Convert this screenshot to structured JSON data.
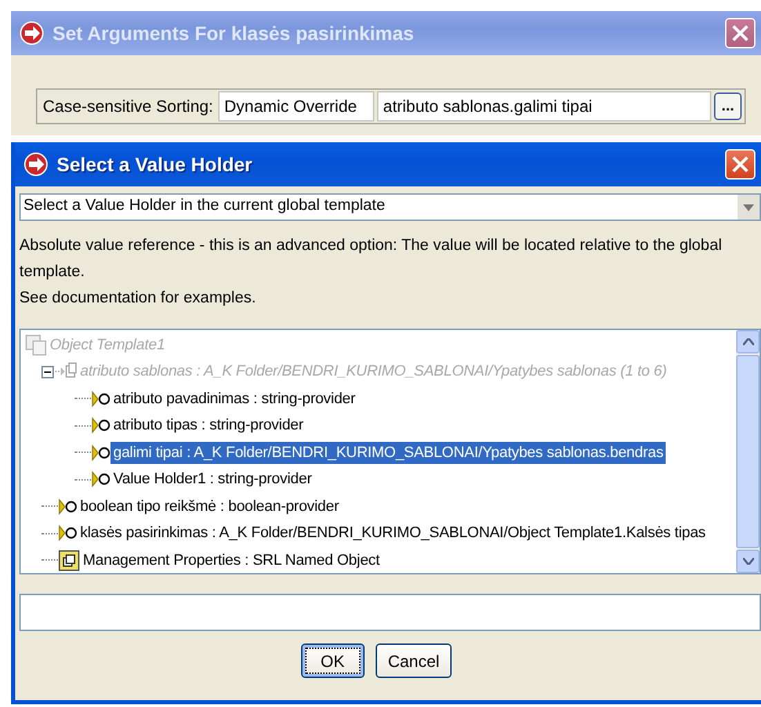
{
  "outer_window": {
    "title": "Set Arguments For klasės pasirinkimas",
    "argument": {
      "label": "Case-sensitive Sorting:",
      "mode": "Dynamic Override",
      "value": "atributo sablonas.galimi tipai",
      "browse_button": "..."
    }
  },
  "dialog": {
    "title": "Select a Value Holder",
    "dropdown": {
      "value": "Select a Value Holder in the current global template"
    },
    "description": [
      "Absolute value reference - this is an advanced option: The value will be located relative to the global template.",
      "See documentation for examples."
    ],
    "tree": [
      {
        "label": "Object Template1",
        "kind": "template",
        "disabled": true,
        "selected": false,
        "children": [
          {
            "label": "atributo sablonas : A_K Folder/BENDRI_KURIMO_SABLONAI/Ypatybes sablonas (1 to 6)",
            "kind": "group",
            "disabled": true,
            "selected": false,
            "expanded": true,
            "children": [
              {
                "label": "atributo pavadinimas : string-provider",
                "kind": "provider",
                "disabled": false,
                "selected": false
              },
              {
                "label": "atributo tipas : string-provider",
                "kind": "provider",
                "disabled": false,
                "selected": false
              },
              {
                "label": "galimi tipai : A_K Folder/BENDRI_KURIMO_SABLONAI/Ypatybes sablonas.bendras",
                "kind": "provider",
                "disabled": false,
                "selected": true
              },
              {
                "label": "Value Holder1 : string-provider",
                "kind": "provider",
                "disabled": false,
                "selected": false
              }
            ]
          },
          {
            "label": "boolean tipo reikšmė : boolean-provider",
            "kind": "provider",
            "disabled": false,
            "selected": false
          },
          {
            "label": "klasės pasirinkimas : A_K Folder/BENDRI_KURIMO_SABLONAI/Object Template1.Kalsės tipas",
            "kind": "provider",
            "disabled": false,
            "selected": false
          },
          {
            "label": "Management Properties : SRL Named Object",
            "kind": "object",
            "disabled": false,
            "selected": false
          }
        ]
      }
    ],
    "buttons": [
      {
        "label": "OK",
        "focused": true
      },
      {
        "label": "Cancel",
        "focused": false
      }
    ]
  }
}
